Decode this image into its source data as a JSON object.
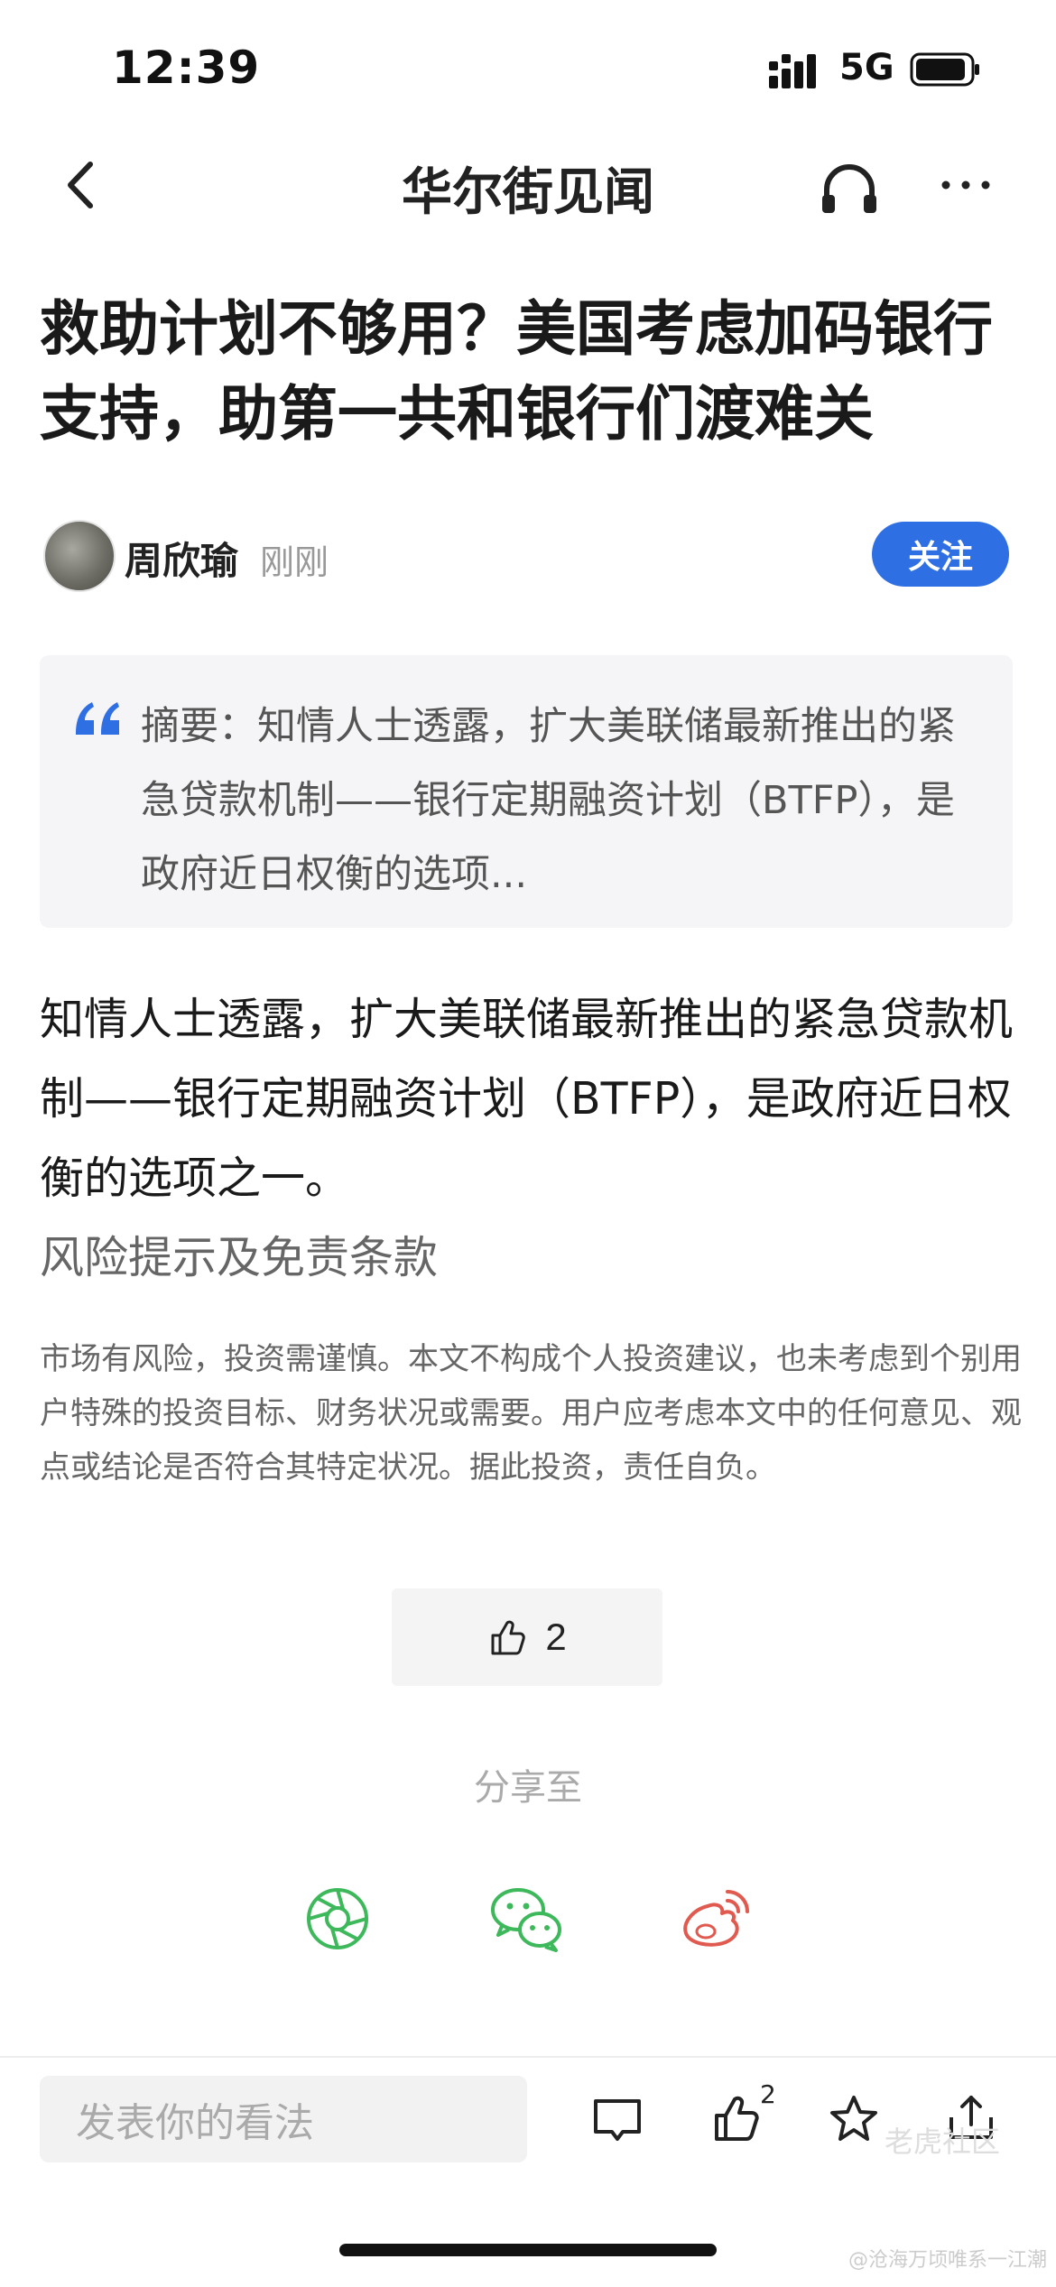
{
  "status_bar": {
    "time": "12:39",
    "network": "5G"
  },
  "nav": {
    "title": "华尔街见闻"
  },
  "article": {
    "headline": "救助计划不够用？美国考虑加码银行支持，助第一共和银行们渡难关",
    "author": "周欣瑜",
    "published": "刚刚",
    "follow_label": "关注",
    "summary": "摘要：知情人士透露，扩大美联储最新推出的紧急贷款机制——银行定期融资计划（BTFP），是政府近日权衡的选项...",
    "body": "知情人士透露，扩大美联储最新推出的紧急贷款机制——银行定期融资计划（BTFP），是政府近日权衡的选项之一。",
    "risk_title": "风险提示及免责条款",
    "disclaimer": "市场有风险，投资需谨慎。本文不构成个人投资建议，也未考虑到个别用户特殊的投资目标、财务状况或需要。用户应考虑本文中的任何意见、观点或结论是否符合其特定状况。据此投资，责任自负。"
  },
  "like": {
    "count": "2"
  },
  "share": {
    "label": "分享至",
    "targets": [
      "moments-icon",
      "wechat-icon",
      "weibo-icon"
    ]
  },
  "bottom_bar": {
    "comment_placeholder": "发表你的看法",
    "like_badge": "2"
  },
  "watermark": {
    "text": "老虎社区",
    "subtext": "@沧海万顷唯系一江潮"
  },
  "colors": {
    "accent": "#2f6fe4",
    "wechat_green": "#3db85a",
    "weibo_red": "#e05a4f"
  }
}
